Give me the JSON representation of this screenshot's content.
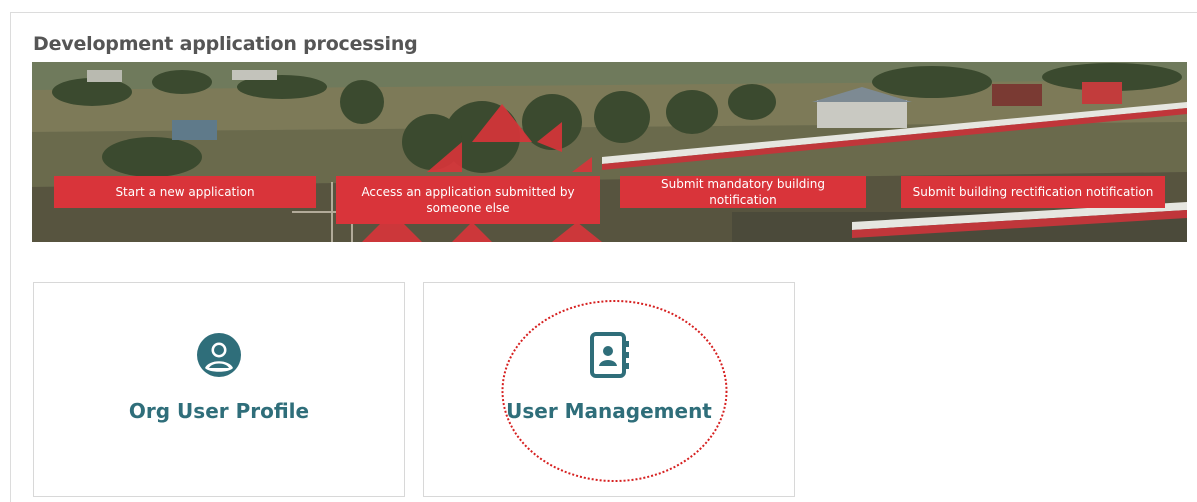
{
  "section": {
    "title": "Development application processing"
  },
  "banner": {
    "buttons": [
      {
        "label": "Start a new application"
      },
      {
        "label": "Access an application submitted by someone else"
      },
      {
        "label": "Submit mandatory building notification"
      },
      {
        "label": "Submit building rectification notification"
      }
    ]
  },
  "tiles": [
    {
      "label": "Org User Profile",
      "icon": "user-circle-icon"
    },
    {
      "label": "User Management",
      "icon": "address-book-icon"
    }
  ],
  "colors": {
    "accent_red": "#d9343a",
    "teal": "#2f6e7a",
    "title_gray": "#555555"
  }
}
